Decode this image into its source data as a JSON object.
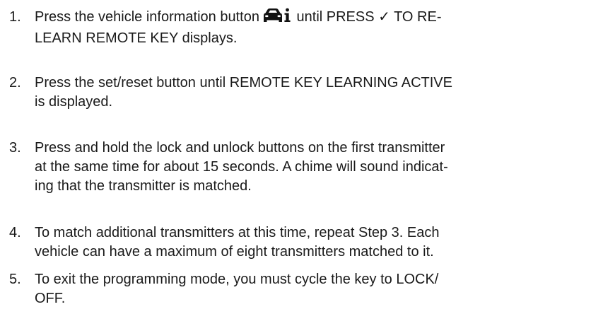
{
  "steps": [
    {
      "number": "1.",
      "line1_before_icon": "Press the vehicle information button",
      "icon": "vehicle-information-icon",
      "line1_after_icon": "until PRESS ✓ TO RE-",
      "lines_rest": [
        "LEARN REMOTE KEY displays."
      ]
    },
    {
      "number": "2.",
      "lines": [
        "Press the set/reset button until REMOTE KEY LEARNING ACTIVE",
        "is displayed."
      ]
    },
    {
      "number": "3.",
      "lines": [
        "Press and hold the lock and unlock buttons on the first transmitter",
        "at the same time for about 15 seconds. A chime will sound indicat-",
        "ing that the transmitter is matched."
      ]
    },
    {
      "number": "4.",
      "lines": [
        "To match additional transmitters at this time, repeat Step 3. Each",
        "vehicle can have a maximum of eight transmitters matched to it."
      ]
    },
    {
      "number": "5.",
      "lines": [
        "To exit the programming mode, you must cycle the key to LOCK/",
        "OFF."
      ]
    }
  ]
}
